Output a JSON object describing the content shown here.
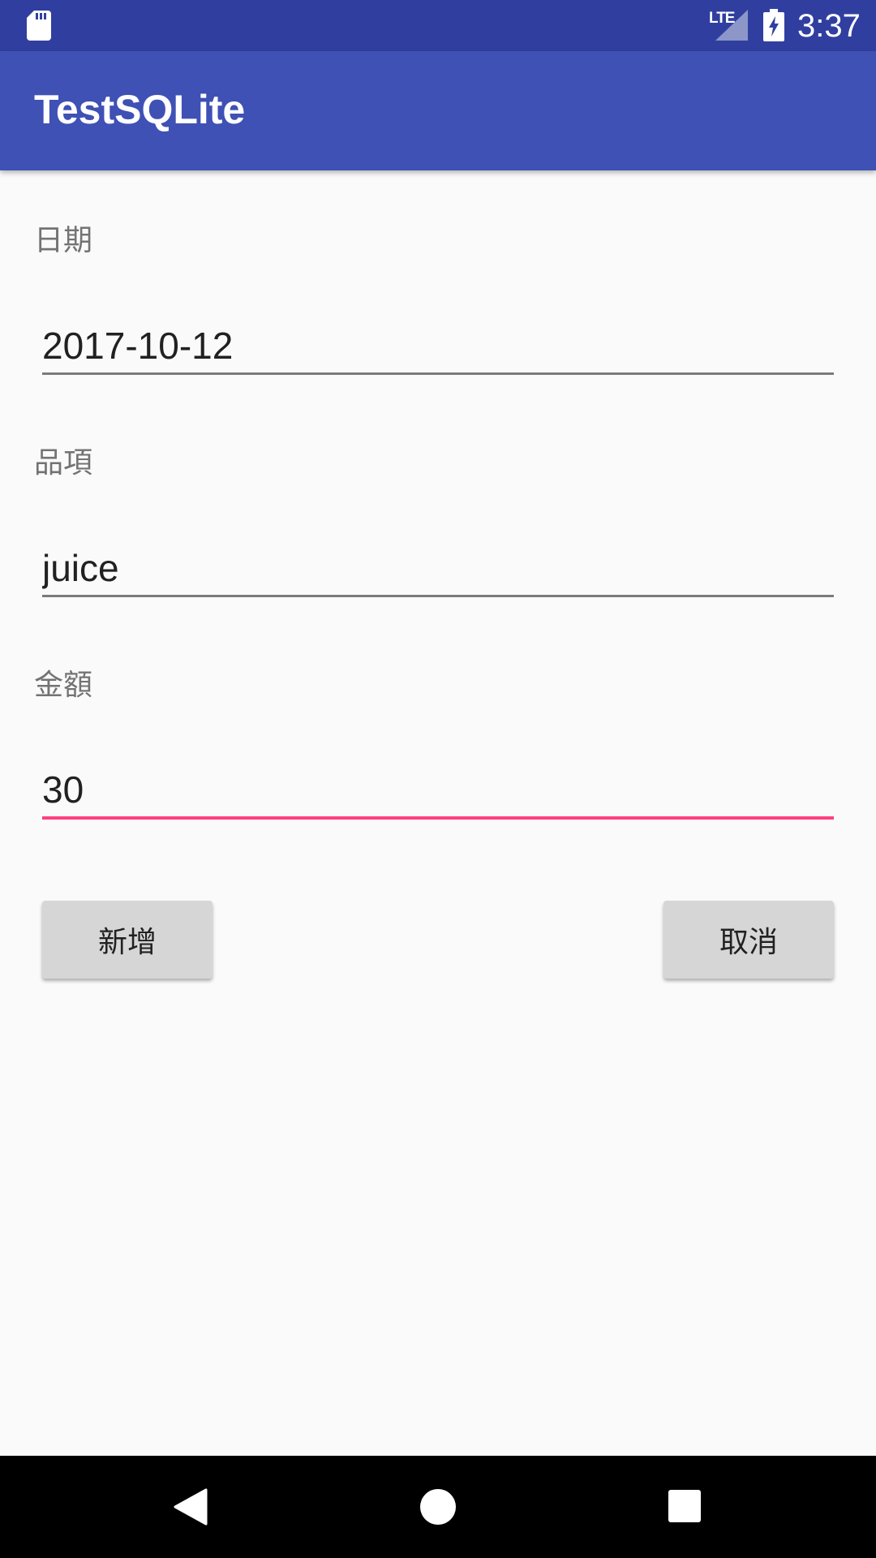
{
  "status_bar": {
    "network": "LTE",
    "time": "3:37",
    "icons": [
      "sd-card-icon",
      "signal-icon",
      "battery-charging-icon"
    ]
  },
  "app_bar": {
    "title": "TestSQLite",
    "color": "#3f51b5"
  },
  "form": {
    "date": {
      "label": "日期",
      "value": "2017-10-12"
    },
    "item": {
      "label": "品項",
      "value": "juice"
    },
    "amount": {
      "label": "金額",
      "value": "30"
    }
  },
  "buttons": {
    "add_label": "新增",
    "cancel_label": "取消"
  },
  "nav_bar": {
    "icons": [
      "back-icon",
      "home-icon",
      "recents-icon"
    ]
  },
  "colors": {
    "status_bar": "#303f9f",
    "accent": "#ff4081"
  }
}
